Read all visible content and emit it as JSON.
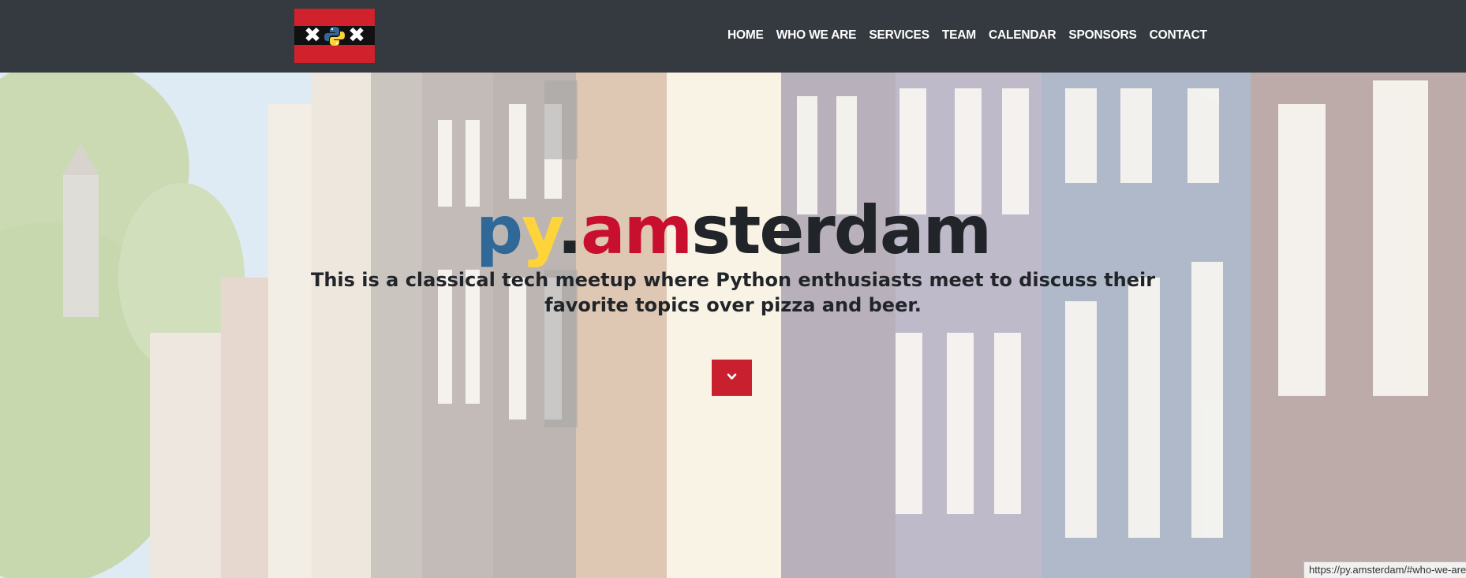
{
  "navbar": {
    "logo_alt": "py.amsterdam logo",
    "links": [
      "HOME",
      "WHO WE ARE",
      "SERVICES",
      "TEAM",
      "CALENDAR",
      "SPONSORS",
      "CONTACT"
    ]
  },
  "hero": {
    "title_parts": {
      "p": "p",
      "y": "y",
      "dot": ".",
      "am": "am",
      "rest": "sterdam"
    },
    "subtitle": "This is a classical tech meetup where Python enthusiasts meet to discuss their favorite topics over pizza and beer.",
    "scroll_button_icon": "chevron-down-icon"
  },
  "status_bar": {
    "url": "https://py.amsterdam/#who-we-are"
  },
  "colors": {
    "navbar_bg": "#343a40",
    "brand_red": "#c8202f",
    "python_blue": "#306998",
    "python_yellow": "#ffd43b"
  }
}
